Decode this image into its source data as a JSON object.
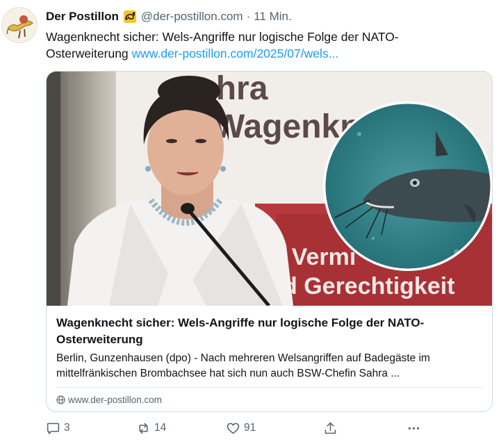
{
  "post": {
    "author_name": "Der Postillon",
    "handle": "@der-postillon.com",
    "separator": "·",
    "time": "11 Min.",
    "text": "Wagenknecht sicher: Wels-Angriffe nur logische Folge der NATO-Osterweiterung ",
    "link": "www.der-postillon.com/2025/07/wels..."
  },
  "card": {
    "title": "Wagenknecht sicher: Wels-Angriffe nur logische Folge der NATO-Osterweiterung",
    "description": "Berlin, Gunzenhausen (dpo) - Nach mehreren Welsangriffen auf Badegäste im mittelfränkischen Brombachsee hat sich nun auch BSW-Chefin Sahra ...",
    "source": "www.der-postillon.com",
    "image_sign_lines": [
      "Sahra",
      "Wagenkn",
      "r Vermi",
      "d Gerechtigkeit"
    ]
  },
  "actions": {
    "replies": "3",
    "reposts": "14",
    "likes": "91"
  },
  "colors": {
    "link": "#1d9bf0",
    "muted": "#536471",
    "text": "#0f1419",
    "border": "#cfd9de"
  },
  "icons": [
    "postillon-avatar-icon",
    "postal-horn-badge-icon",
    "globe-icon",
    "reply-icon",
    "repost-icon",
    "like-icon",
    "share-icon",
    "more-icon"
  ]
}
